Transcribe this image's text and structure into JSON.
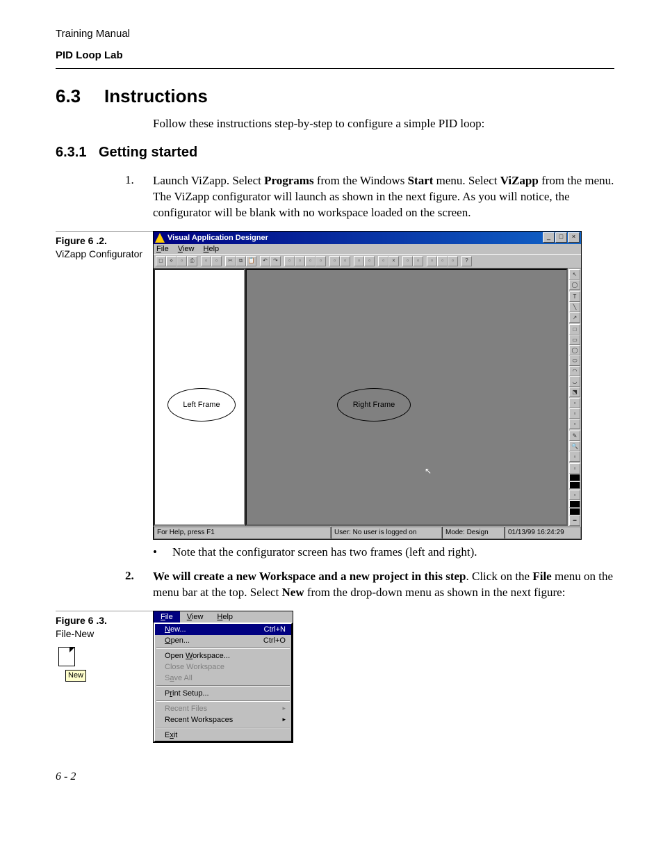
{
  "header": {
    "line1": "Training Manual",
    "line2": "PID Loop Lab"
  },
  "section": {
    "num": "6.3",
    "title": "Instructions"
  },
  "intro": "Follow these instructions step-by-step to configure a simple PID loop:",
  "subsection": {
    "num": "6.3.1",
    "title": "Getting started"
  },
  "step1": {
    "num": "1.",
    "pre": "Launch ViZapp. Select ",
    "b1": "Programs",
    "mid1": " from the Windows ",
    "b2": "Start",
    "mid2": " menu. Select ",
    "b3": "ViZapp",
    "post": " from the menu. The ViZapp configurator will launch as shown in the next figure. As you will notice, the configurator will be blank with no workspace loaded on the screen."
  },
  "fig62": {
    "title": "Figure 6 .2.",
    "caption": "ViZapp Configurator"
  },
  "app": {
    "title": "Visual Application Designer",
    "menu": {
      "file": "File",
      "view": "View",
      "help": "Help"
    },
    "left_label": "Left Frame",
    "right_label": "Right Frame",
    "status": {
      "help": "For Help, press F1",
      "user": "User:  No user is logged on",
      "mode": "Mode:   Design",
      "time": "01/13/99  16:24:29"
    },
    "winbtns": {
      "min": "_",
      "max": "□",
      "close": "×"
    }
  },
  "bullet1": "Note that the configurator screen has two frames (left and right).",
  "step2": {
    "num": "2.",
    "b1": "We will create a new Workspace and a new project in this step",
    "mid1": ". Click on the ",
    "b2": "File",
    "mid2": " menu on the menu bar at the top. Select ",
    "b3": "New",
    "post": " from the drop-down menu as shown in the next figure:"
  },
  "fig63": {
    "title": "Figure 6 .3.",
    "caption": "File-New",
    "tooltip": "New"
  },
  "filemenu": {
    "bar": {
      "file": "File",
      "view": "View",
      "help": "Help"
    },
    "items": {
      "new": {
        "label": "New...",
        "accel": "Ctrl+N"
      },
      "open": {
        "label": "Open...",
        "accel": "Ctrl+O"
      },
      "openws": "Open Workspace...",
      "closews": "Close Workspace",
      "saveall": "Save All",
      "printsetup": "Print Setup...",
      "recentfiles": "Recent Files",
      "recentws": "Recent Workspaces",
      "exit": "Exit"
    }
  },
  "page_num": "6 - 2"
}
